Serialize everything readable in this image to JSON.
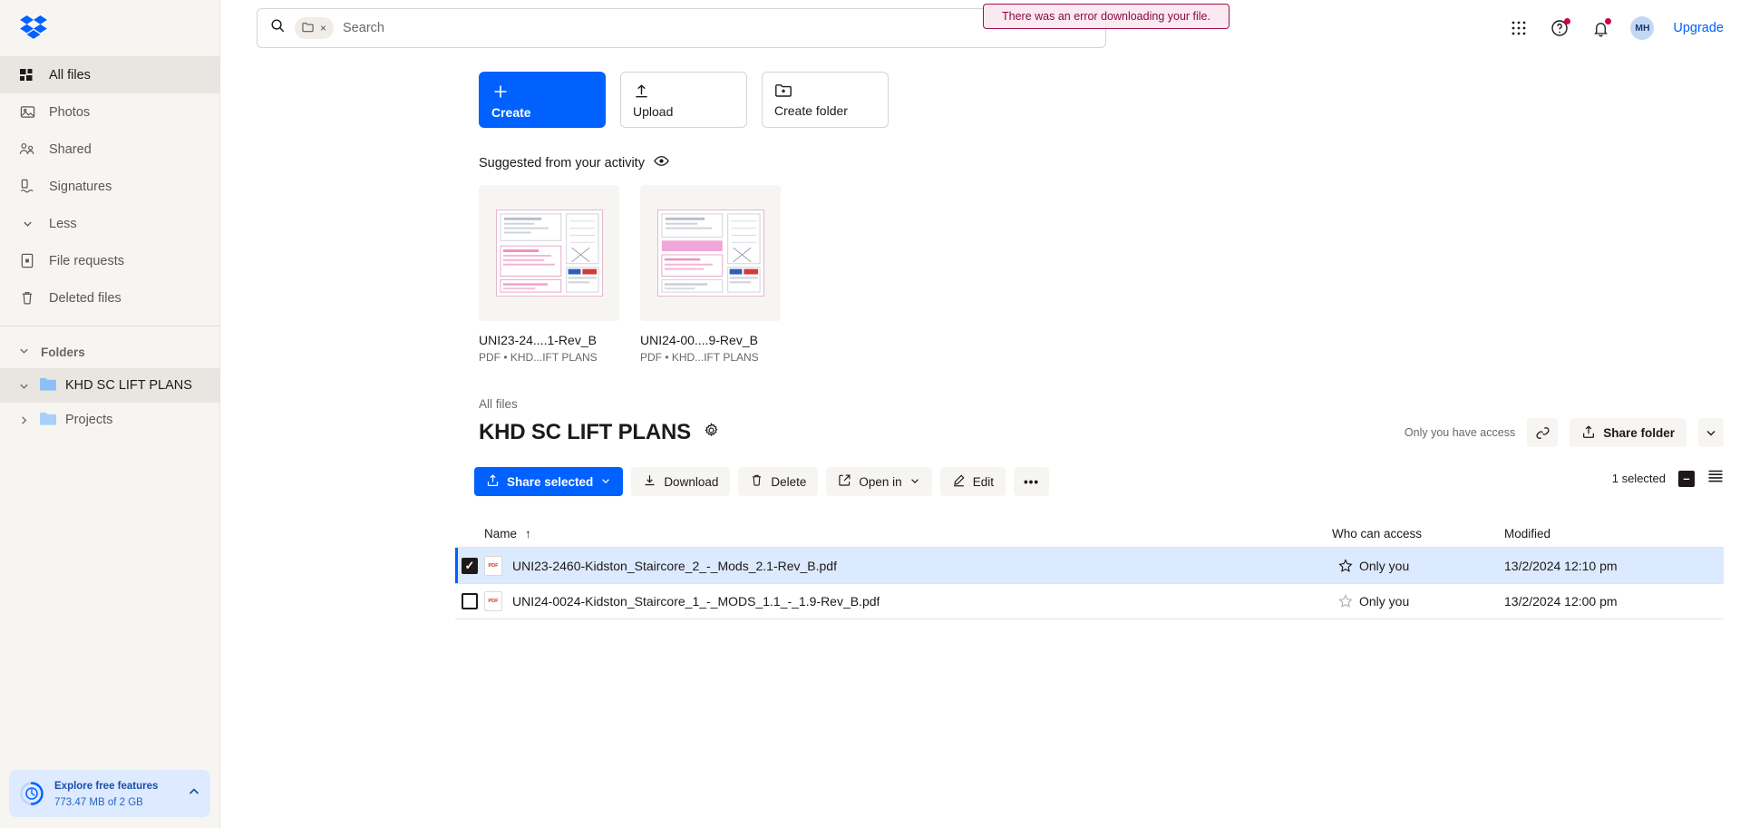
{
  "brand": {
    "name": "dropbox",
    "accent": "#0061fe",
    "error_color": "#a01050"
  },
  "sidebar": {
    "items": [
      {
        "label": "All files",
        "icon": "files-icon"
      },
      {
        "label": "Photos",
        "icon": "photo-icon"
      },
      {
        "label": "Shared",
        "icon": "shared-people-icon"
      },
      {
        "label": "Signatures",
        "icon": "signature-icon"
      },
      {
        "label": "Less",
        "icon": "chevron-down-icon"
      },
      {
        "label": "File requests",
        "icon": "file-request-icon"
      },
      {
        "label": "Deleted files",
        "icon": "trash-icon"
      }
    ],
    "folders_header": "Folders",
    "tree": [
      {
        "label": "KHD SC LIFT PLANS",
        "expanded": true,
        "active": true
      },
      {
        "label": "Projects",
        "expanded": false,
        "active": false
      }
    ],
    "storage": {
      "title": "Explore free features",
      "usage": "773.47 MB of 2 GB"
    }
  },
  "search": {
    "placeholder": "Search",
    "value": "",
    "chip_icon": "folder-icon",
    "chip_close": "×"
  },
  "topbar": {
    "grid_icon": "apps-grid-icon",
    "help_icon": "help-circle-icon",
    "bell_icon": "notification-bell-icon",
    "avatar_initials": "MH",
    "upgrade": "Upgrade"
  },
  "toast": {
    "message": "There was an error downloading your file."
  },
  "actions": [
    {
      "label": "Create",
      "icon": "plus-icon",
      "primary": true
    },
    {
      "label": "Upload",
      "icon": "upload-arrow-icon",
      "primary": false
    },
    {
      "label": "Create folder",
      "icon": "folder-plus-icon",
      "primary": false
    }
  ],
  "suggested": {
    "heading": "Suggested from your activity",
    "eye_icon": "eye-icon",
    "cards": [
      {
        "title": "UNI23-24....1-Rev_B",
        "subtitle": "PDF • KHD...IFT PLANS"
      },
      {
        "title": "UNI24-00....9-Rev_B",
        "subtitle": "PDF • KHD...IFT PLANS"
      }
    ]
  },
  "breadcrumb": "All files",
  "folder": {
    "title": "KHD SC LIFT PLANS",
    "settings_icon": "gear-icon",
    "access_note": "Only you have access",
    "copy_link_icon": "link-icon",
    "share_button": "Share folder",
    "share_caret_icon": "chevron-down-icon"
  },
  "toolbar": {
    "buttons": [
      {
        "label": "Share selected",
        "icon": "share-upload-icon",
        "caret": true,
        "primary": true
      },
      {
        "label": "Download",
        "icon": "download-icon",
        "caret": false,
        "primary": false
      },
      {
        "label": "Delete",
        "icon": "trash-icon",
        "caret": false,
        "primary": false
      },
      {
        "label": "Open in",
        "icon": "open-external-icon",
        "caret": true,
        "primary": false
      },
      {
        "label": "Edit",
        "icon": "pencil-icon",
        "caret": false,
        "primary": false
      },
      {
        "label": "•••",
        "icon": "more-horizontal-icon",
        "caret": false,
        "primary": false
      }
    ],
    "selected_count": "1 selected",
    "select_all_state": "indeterminate",
    "view_icon": "list-view-icon"
  },
  "table": {
    "columns": {
      "name": "Name",
      "sort_icon": "↑",
      "access": "Who can access",
      "modified": "Modified"
    },
    "rows": [
      {
        "name": "UNI23-2460-Kidston_Staircore_2_-_Mods_2.1-Rev_B.pdf",
        "type": "PDF",
        "access": "Only you",
        "modified": "13/2/2024 12:10 pm",
        "selected": true,
        "starred": false
      },
      {
        "name": "UNI24-0024-Kidston_Staircore_1_-_MODS_1.1_-_1.9-Rev_B.pdf",
        "type": "PDF",
        "access": "Only you",
        "modified": "13/2/2024 12:00 pm",
        "selected": false,
        "starred": false
      }
    ]
  }
}
